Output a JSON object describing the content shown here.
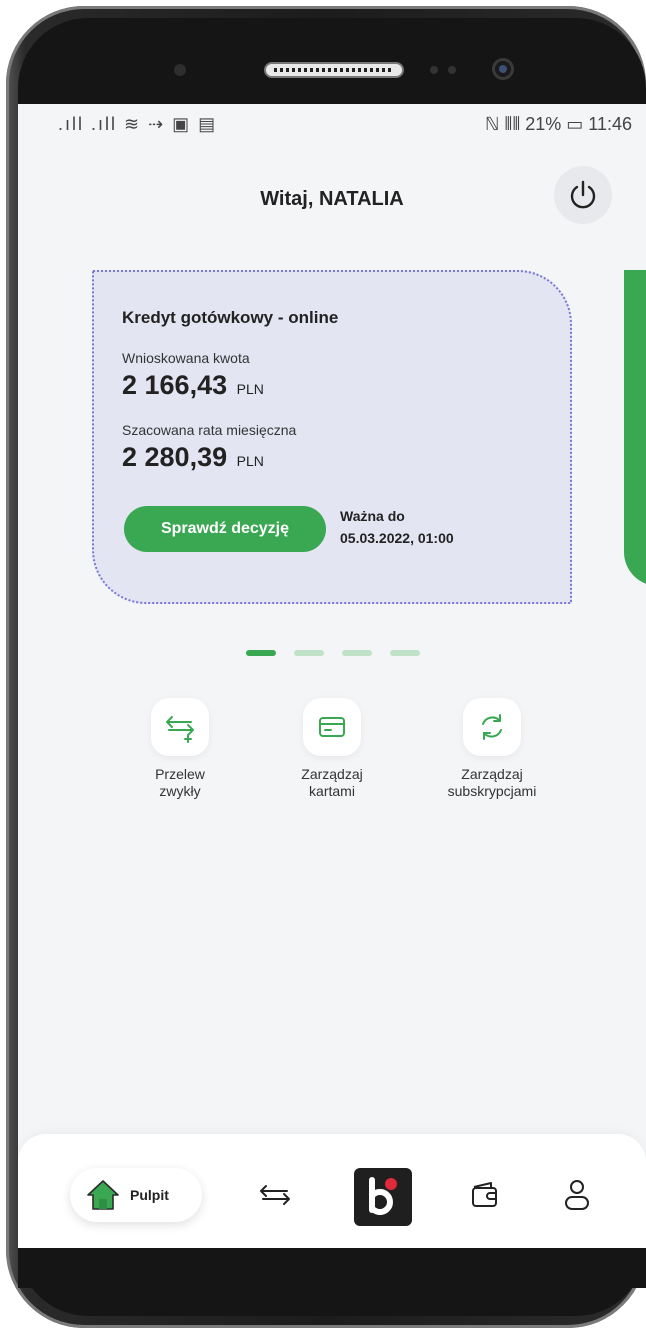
{
  "status_bar": {
    "left": ".ıll .ıll ≋ ⇢ ▣ ▤",
    "right": "ℕ ⦀⦀ 21% ▭ 11:46",
    "battery": "21%",
    "time": "11:46"
  },
  "header": {
    "greeting": "Witaj, NATALIA"
  },
  "loan_card": {
    "title": "Kredyt gotówkowy - online",
    "requested_label": "Wnioskowana kwota",
    "requested_value": "2 166,43",
    "currency": "PLN",
    "installment_label": "Szacowana rata miesięczna",
    "installment_value": "2 280,39",
    "cta_label": "Sprawdź decyzję",
    "valid_label": "Ważna do",
    "valid_date": "05.03.2022, 01:00"
  },
  "carousel": {
    "pages": 4,
    "active_index": 0
  },
  "quick_actions": [
    {
      "label": "Przelew\nzwykły",
      "icon": "transfer-plus-icon"
    },
    {
      "label": "Zarządzaj\nkartami",
      "icon": "card-icon"
    },
    {
      "label": "Zarządzaj\nsubskrypcjami",
      "icon": "refresh-icon"
    }
  ],
  "bottom_nav": {
    "home_label": "Pulpit",
    "items": [
      "transfers-icon",
      "brand-logo",
      "wallet-icon",
      "profile-icon"
    ]
  },
  "colors": {
    "accent": "#3aa852",
    "card_bg": "#e4e5f3",
    "card_border": "#7a77d4"
  }
}
